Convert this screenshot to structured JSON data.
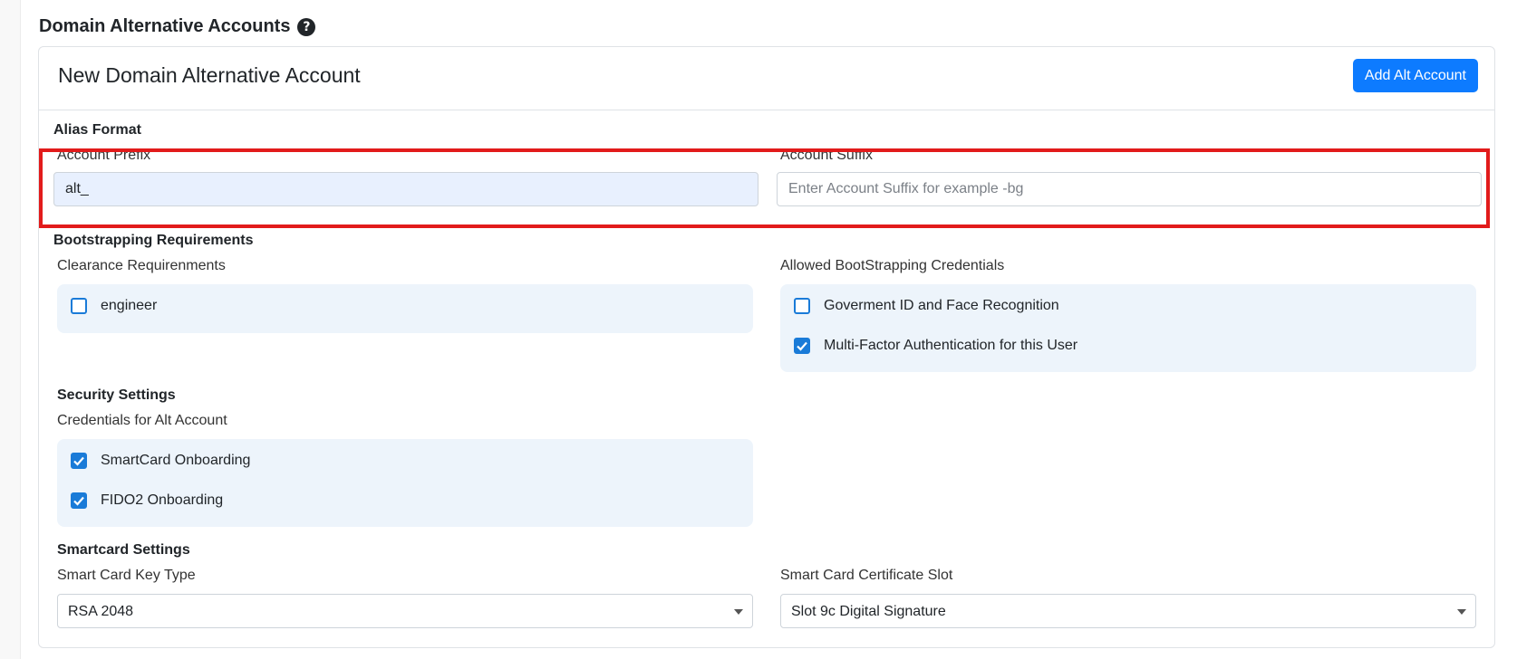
{
  "section": {
    "title": "Domain Alternative Accounts",
    "help_icon": "question-circle-icon"
  },
  "card": {
    "title": "New Domain Alternative Account",
    "add_button_label": "Add Alt Account"
  },
  "alias_format": {
    "heading": "Alias Format",
    "prefix": {
      "label": "Account Prefix",
      "value": "alt_"
    },
    "suffix": {
      "label": "Account Suffix",
      "placeholder": "Enter Account Suffix for example -bg"
    }
  },
  "bootstrapping": {
    "heading": "Bootstrapping Requirements",
    "clearance": {
      "label": "Clearance Requirenments",
      "options": [
        {
          "label": "engineer",
          "checked": false
        }
      ]
    },
    "credentials": {
      "label": "Allowed BootStrapping Credentials",
      "options": [
        {
          "label": "Goverment ID and Face Recognition",
          "checked": false
        },
        {
          "label": "Multi-Factor Authentication for this User",
          "checked": true
        }
      ]
    }
  },
  "security": {
    "heading": "Security Settings",
    "credentials_label": "Credentials for Alt Account",
    "options": [
      {
        "label": "SmartCard Onboarding",
        "checked": true
      },
      {
        "label": "FIDO2 Onboarding",
        "checked": true
      }
    ]
  },
  "smartcard": {
    "heading": "Smartcard Settings",
    "key_type": {
      "label": "Smart Card Key Type",
      "selected": "RSA 2048"
    },
    "cert_slot": {
      "label": "Smart Card Certificate Slot",
      "selected": "Slot 9c Digital Signature"
    }
  },
  "colors": {
    "primary": "#0d7bff",
    "highlight": "#e21b1b",
    "panel": "#edf4fb",
    "checkbox": "#1a7bd8"
  }
}
